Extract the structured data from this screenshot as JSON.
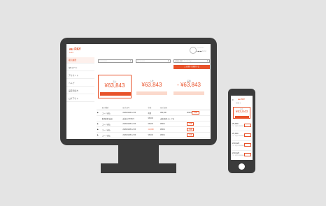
{
  "desktop": {
    "logo": "au PAY",
    "logo_sub": "for BIZ",
    "user": {
      "name": "○○○○○○○○",
      "rank": "●●●●●○○○○"
    },
    "sidebar": [
      "取引履歴",
      "QRコード",
      "アカウント",
      "ヘルプ",
      "設定手続き",
      "ログアウト"
    ],
    "filters": [
      {
        "label": "2021/01/01",
        "arrow": "▼"
      },
      {
        "label": "2021/01/31",
        "arrow": "▼"
      },
      {
        "label": "店舗を選択してください",
        "arrow": "▼"
      }
    ],
    "search_label": "この条件で検索する",
    "cards": [
      {
        "label": "売上",
        "amount": "¥63,843",
        "button": "この取引を承認する"
      },
      {
        "label": "入金",
        "amount": "¥63,843",
        "button": ""
      },
      {
        "label": "差額",
        "amount": "- ¥63,843",
        "button": ""
      }
    ],
    "table": {
      "headers": [
        "",
        "取引種別",
        "取引日時",
        "状態",
        "取引金額",
        ""
      ],
      "rows": [
        {
          "arrow": "▶",
          "type": "コード支払",
          "date": "2020/01/08 12:33",
          "status": "利用",
          "amount": "¥80,000",
          "id": "#0001",
          "detail": "詳細"
        },
        {
          "arrow": "",
          "type": "取消処理 返品",
          "date": "返金日 03/2021",
          "status": "¥5,000",
          "amount": "返金処理 ストア名",
          "id": "",
          "detail": ""
        },
        {
          "arrow": "▶",
          "type": "コード支払",
          "date": "2020/01/08 12:33",
          "status": "¥5,000",
          "amount": "#0001",
          "id": "",
          "detail": "詳細"
        },
        {
          "arrow": "▶",
          "type": "コード支払",
          "date": "2020/01/08 12:33",
          "status": "-10,000",
          "amount": "#0001",
          "id": "",
          "detail": "詳細"
        },
        {
          "arrow": "▶",
          "type": "コード支払",
          "date": "2020/01/08 12:33",
          "status": "¥5,000",
          "amount": "#0001",
          "id": "",
          "detail": "詳細"
        }
      ]
    }
  },
  "mobile": {
    "menu": "≡",
    "logo": "au PAY",
    "user": "●●●● ▾",
    "card": {
      "label": "売上",
      "amount": "¥63,843"
    },
    "items": [
      {
        "amount": "¥5,000",
        "sub": "コード支払 2020/01/08"
      },
      {
        "amount": "¥5,000",
        "sub": "コード支払 2020/01/08"
      },
      {
        "amount": "¥10,423",
        "sub": "コード支払 2020/01/08"
      },
      {
        "amount": "¥10,423",
        "sub": "コード支払 2020/01/08"
      }
    ]
  },
  "colors": {
    "accent": "#e8522a",
    "device": "#3b3b3b",
    "background": "#e4e4e4"
  }
}
